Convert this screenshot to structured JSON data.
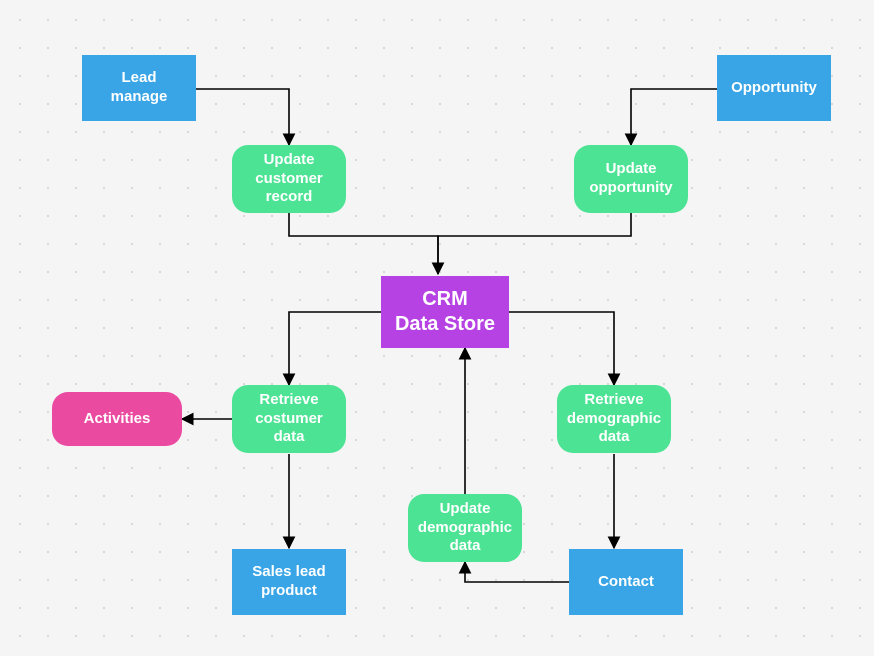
{
  "nodes": {
    "lead_manage": "Lead manage",
    "opportunity": "Opportunity",
    "update_customer": "Update customer record",
    "update_opportunity": "Update opportunity",
    "crm": "CRM\nData Store",
    "retrieve_customer": "Retrieve costumer data",
    "retrieve_demo": "Retrieve demographic data",
    "activities": "Activities",
    "update_demo": "Update demographic data",
    "sales_lead": "Sales lead product",
    "contact": "Contact"
  }
}
